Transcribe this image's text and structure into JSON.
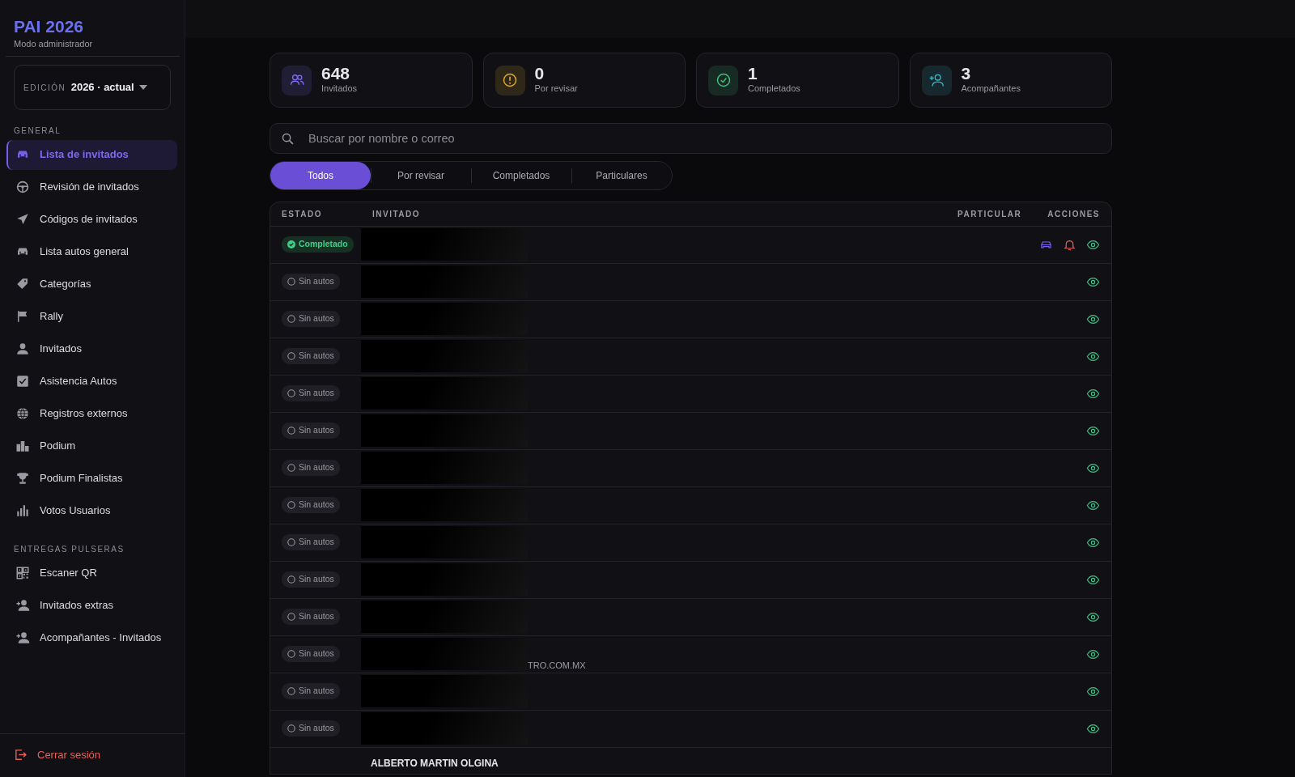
{
  "brand": {
    "title": "PAI 2026",
    "subtitle": "Modo administrador"
  },
  "edition": {
    "label": "EDICIÓN",
    "value": "2026 · actual"
  },
  "sidebar": {
    "sections": [
      {
        "heading": "GENERAL",
        "items": [
          {
            "label": "Lista de invitados",
            "selected": true
          },
          {
            "label": "Revisión de invitados",
            "selected": false
          },
          {
            "label": "Códigos de invitados",
            "selected": false
          },
          {
            "label": "Lista autos general",
            "selected": false
          },
          {
            "label": "Categorías",
            "selected": false
          },
          {
            "label": "Rally",
            "selected": false
          },
          {
            "label": "Invitados",
            "selected": false
          },
          {
            "label": "Asistencia Autos",
            "selected": false
          },
          {
            "label": "Registros externos",
            "selected": false
          },
          {
            "label": "Podium",
            "selected": false
          },
          {
            "label": "Podium Finalistas",
            "selected": false
          },
          {
            "label": "Votos Usuarios",
            "selected": false
          }
        ]
      },
      {
        "heading": "ENTREGAS PULSERAS",
        "items": [
          {
            "label": "Escaner QR",
            "selected": false
          },
          {
            "label": "Invitados extras",
            "selected": false
          },
          {
            "label": "Acompañantes - Invitados",
            "selected": false
          }
        ]
      }
    ],
    "logout": "Cerrar sesión"
  },
  "stats": [
    {
      "value": "648",
      "label": "Invitados",
      "color": "#7b6cf0"
    },
    {
      "value": "0",
      "label": "Por revisar",
      "color": "#e0a82e"
    },
    {
      "value": "1",
      "label": "Completados",
      "color": "#3fbf7f"
    },
    {
      "value": "3",
      "label": "Acompañantes",
      "color": "#3ab8c8"
    }
  ],
  "search": {
    "placeholder": "Buscar por nombre o correo"
  },
  "tabs": [
    {
      "label": "Todos",
      "selected": true
    },
    {
      "label": "Por revisar",
      "selected": false
    },
    {
      "label": "Completados",
      "selected": false
    },
    {
      "label": "Particulares",
      "selected": false
    }
  ],
  "table": {
    "columns": [
      "ESTADO",
      "INVITADO",
      "PARTICULAR",
      "ACCIONES"
    ],
    "rows": [
      {
        "status": "Completado",
        "kind": "done"
      },
      {
        "status": "Sin autos",
        "kind": "none"
      },
      {
        "status": "Sin autos",
        "kind": "none"
      },
      {
        "status": "Sin autos",
        "kind": "none"
      },
      {
        "status": "Sin autos",
        "kind": "none"
      },
      {
        "status": "Sin autos",
        "kind": "none"
      },
      {
        "status": "Sin autos",
        "kind": "none"
      },
      {
        "status": "Sin autos",
        "kind": "none"
      },
      {
        "status": "Sin autos",
        "kind": "none"
      },
      {
        "status": "Sin autos",
        "kind": "none"
      },
      {
        "status": "Sin autos",
        "kind": "none"
      },
      {
        "status": "Sin autos",
        "kind": "none",
        "email": "TRO.COM.MX"
      },
      {
        "status": "Sin autos",
        "kind": "none"
      },
      {
        "status": "Sin autos",
        "kind": "none"
      },
      {
        "guest": "ALBERTO MARTIN OLGINA",
        "kind": "partial"
      }
    ]
  }
}
